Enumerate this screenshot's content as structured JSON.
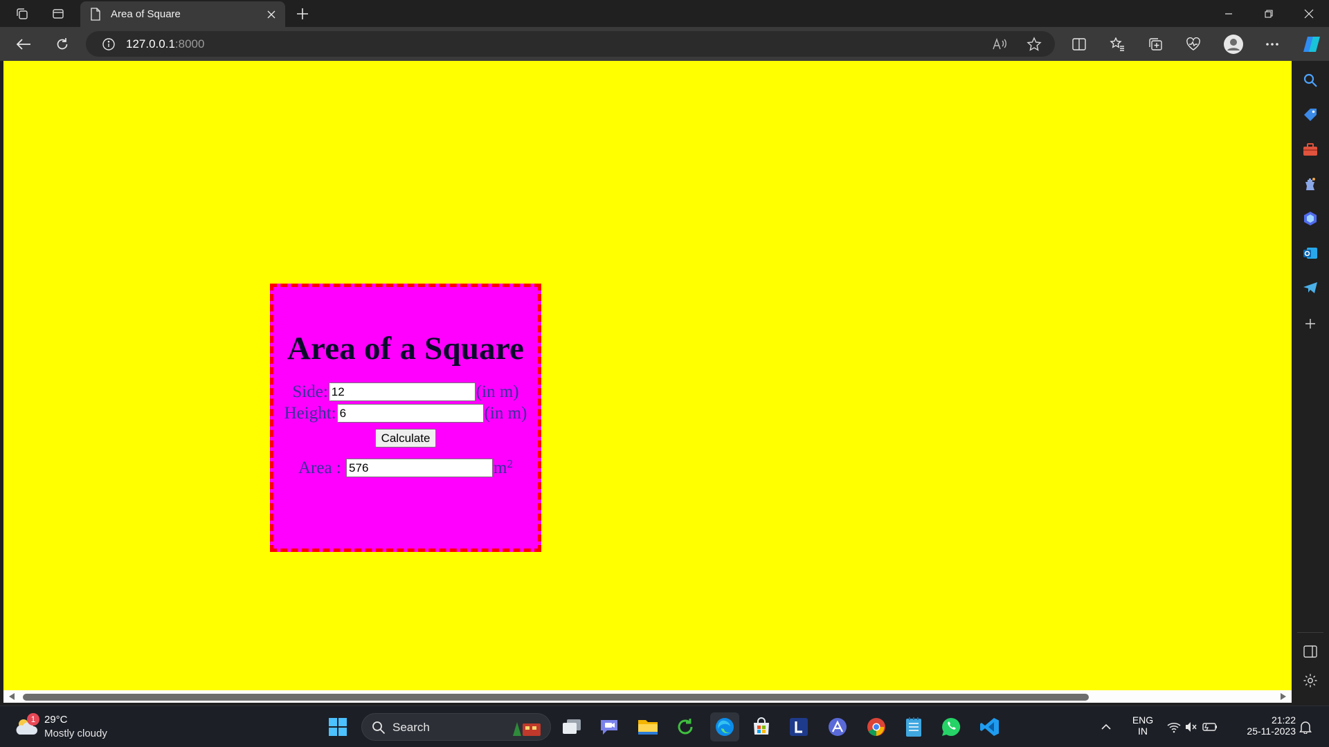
{
  "browser": {
    "tab_title": "Area of Square",
    "url_host": "127.0.0.1",
    "url_port": ":8000"
  },
  "page": {
    "background_color": "#ffff00",
    "card_color": "#ff00ff",
    "card_border_color": "#ff0000",
    "heading": "Area of a Square",
    "side_label": "Side:",
    "side_value": "12",
    "height_label": "Height:",
    "height_value": "6",
    "unit_label": "(in m)",
    "calculate_label": "Calculate",
    "area_label": "Area :",
    "area_value": "576",
    "area_unit": "m",
    "area_unit_exponent": "2"
  },
  "taskbar": {
    "weather_temp": "29°C",
    "weather_condition": "Mostly cloudy",
    "weather_badge": "1",
    "search_label": "Search",
    "language_line1": "ENG",
    "language_line2": "IN",
    "time": "21:22",
    "date": "25-11-2023",
    "pinned_apps": [
      "task-view",
      "teams-chat",
      "file-explorer",
      "refresh-app",
      "edge",
      "microsoft-store",
      "l-app",
      "arc-app",
      "chrome",
      "notepad",
      "whatsapp",
      "vscode"
    ]
  },
  "sidebar": {
    "items": [
      "search",
      "shopping",
      "tools",
      "games",
      "copilot-365",
      "outlook",
      "telegram",
      "add"
    ]
  }
}
